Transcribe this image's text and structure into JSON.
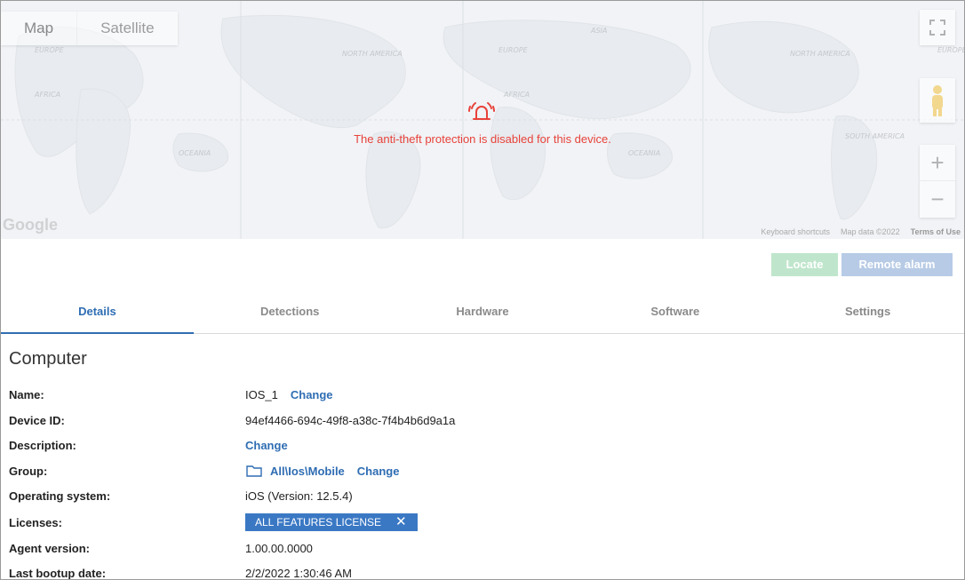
{
  "map": {
    "type_map": "Map",
    "type_satellite": "Satellite",
    "labels": [
      "EUROPE",
      "AFRICA",
      "NORTH AMERICA",
      "EUROPE",
      "ASIA",
      "OCEANIA",
      "NORTH AMERICA",
      "SOUTH AMERICA",
      "OCEANIA",
      "AFRICA",
      "EUROPE"
    ],
    "logo": "Google",
    "footer_shortcuts": "Keyboard shortcuts",
    "footer_data": "Map data ©2022",
    "footer_terms": "Terms of Use",
    "zoom_in": "+",
    "zoom_out": "−",
    "alert_message": "The anti-theft protection is disabled for this device.",
    "alert_color": "#e8423a"
  },
  "actions": {
    "locate": "Locate",
    "remote_alarm": "Remote alarm"
  },
  "tabs": [
    "Details",
    "Detections",
    "Hardware",
    "Software",
    "Settings"
  ],
  "section_title": "Computer",
  "details": {
    "name_label": "Name:",
    "name_value": "IOS_1",
    "change": "Change",
    "device_id_label": "Device ID:",
    "device_id_value": "94ef4466-694c-49f8-a38c-7f4b4b6d9a1a",
    "description_label": "Description:",
    "group_label": "Group:",
    "group_value": "All\\Ios\\Mobile",
    "os_label": "Operating system:",
    "os_value": "iOS (Version: 12.5.4)",
    "licenses_label": "Licenses:",
    "license_badge": "ALL FEATURES LICENSE",
    "license_remove": "✕",
    "agent_label": "Agent version:",
    "agent_value": "1.00.00.0000",
    "bootup_label": "Last bootup date:",
    "bootup_value": "2/2/2022 1:30:46 AM"
  },
  "colors": {
    "accent": "#2f6db3",
    "locate_bg": "#bfe6cc",
    "remote_bg": "#b7cbe6",
    "badge_bg": "#3a78c4"
  }
}
